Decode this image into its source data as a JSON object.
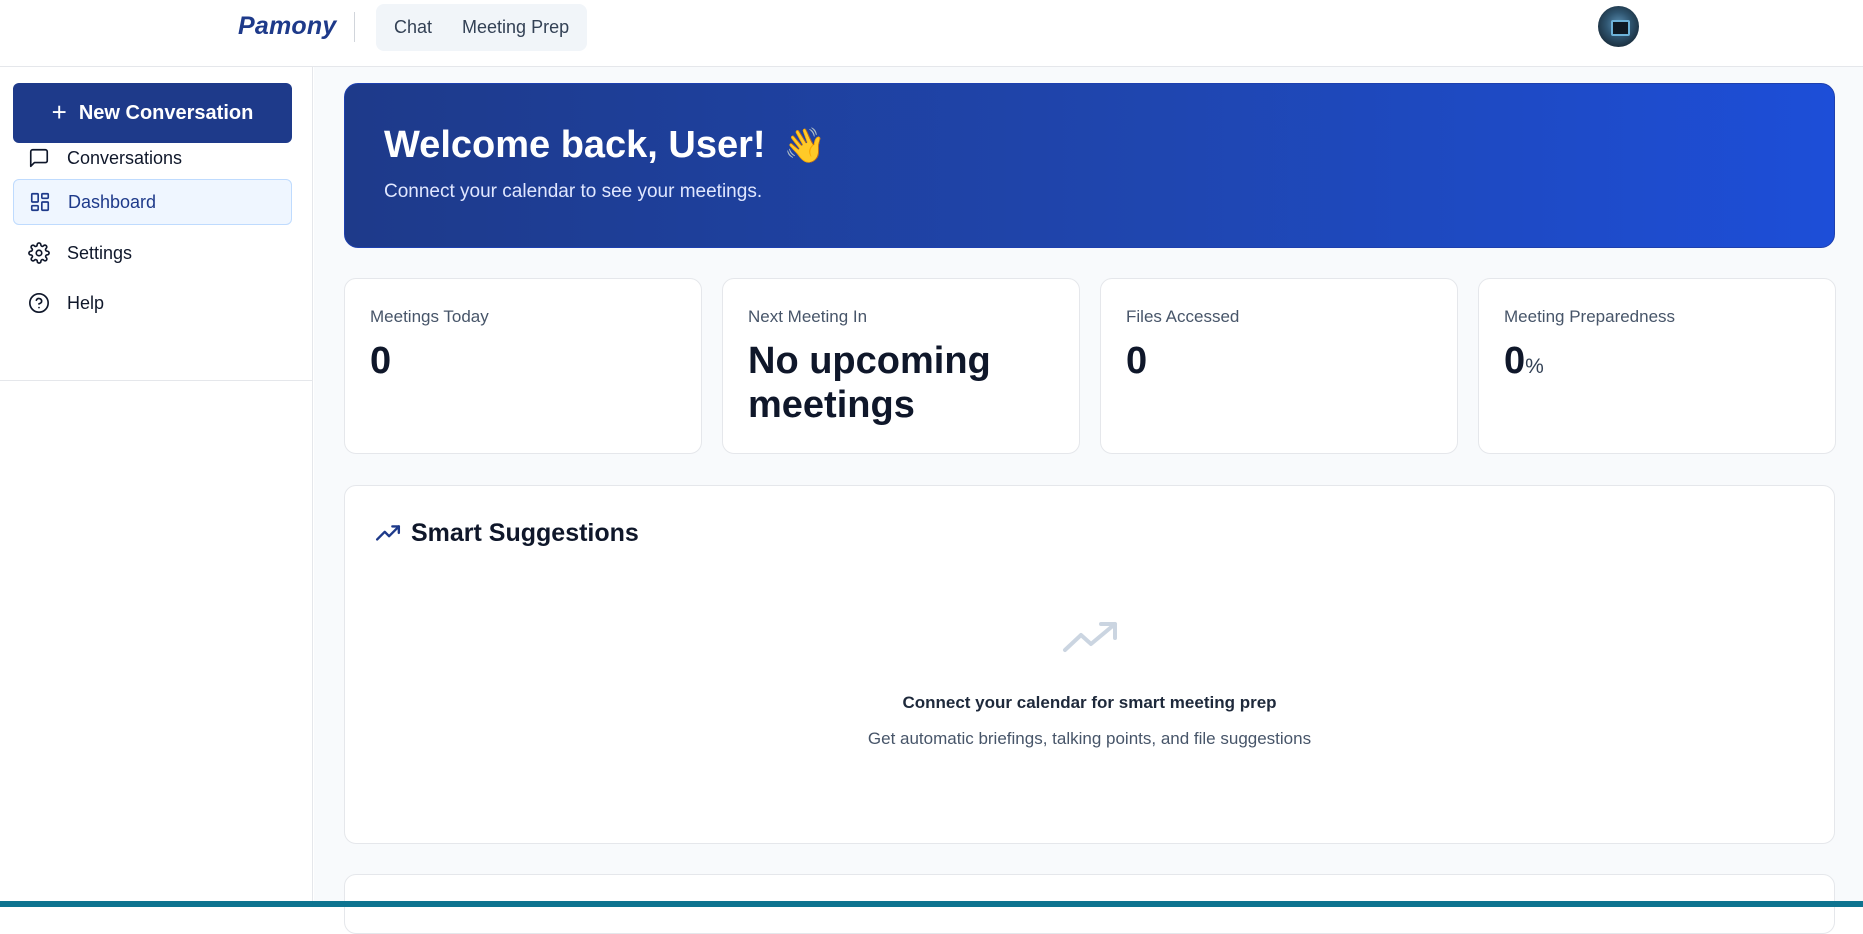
{
  "app": {
    "logo": "Pamony"
  },
  "topnav": {
    "chat": "Chat",
    "meeting_prep": "Meeting Prep"
  },
  "sidebar": {
    "new_conversation": "New Conversation",
    "items": [
      {
        "label": "Conversations",
        "icon": "message-square-icon"
      },
      {
        "label": "Dashboard",
        "icon": "dashboard-grid-icon",
        "active": true
      },
      {
        "label": "Settings",
        "icon": "gear-icon"
      },
      {
        "label": "Help",
        "icon": "help-circle-icon"
      }
    ]
  },
  "hero": {
    "title": "Welcome back, User!",
    "emoji": "👋",
    "subtitle": "Connect your calendar to see your meetings."
  },
  "stats": [
    {
      "label": "Meetings Today",
      "value": "0"
    },
    {
      "label": "Next Meeting In",
      "value": "No upcoming meetings"
    },
    {
      "label": "Files Accessed",
      "value": "0"
    },
    {
      "label": "Meeting Preparedness",
      "value": "0",
      "unit": "%"
    }
  ],
  "suggestions": {
    "title": "Smart Suggestions",
    "empty_title": "Connect your calendar for smart meeting prep",
    "empty_subtitle": "Get automatic briefings, talking points, and file suggestions"
  },
  "colors": {
    "brand": "#1e3a8a",
    "hero_gradient_end": "#1d4ed8",
    "active_nav_bg": "#eff6ff",
    "bottom_bar": "#0e7490"
  }
}
